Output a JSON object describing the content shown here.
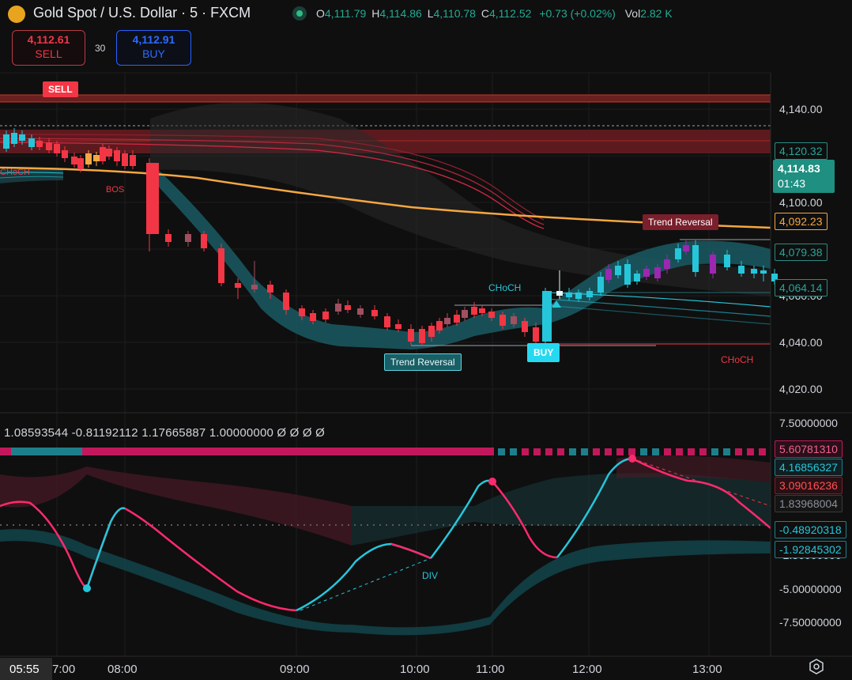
{
  "header": {
    "title": "Gold Spot / U.S. Dollar · 5 · FXCM",
    "ohlc": {
      "o_key": "O",
      "o": "4,111.79",
      "h_key": "H",
      "h": "4,114.86",
      "l_key": "L",
      "l": "4,110.78",
      "c_key": "C",
      "c": "4,112.52",
      "change": "+0.73 (+0.02%)",
      "vol_key": "Vol",
      "vol": "2.82 K"
    }
  },
  "trade": {
    "sell_price": "4,112.61",
    "sell_label": "SELL",
    "buy_price": "4,112.91",
    "buy_label": "BUY",
    "spread": "30"
  },
  "price_axis": {
    "ticks": [
      "4,140.00",
      "4,100.00",
      "4,060.00",
      "4,040.00",
      "4,020.00"
    ],
    "tags": {
      "t4120": "4,120.32",
      "current": "4,114.83",
      "countdown": "01:43",
      "ma": "4,092.23",
      "t4079": "4,079.38",
      "t4064": "4,064.14"
    }
  },
  "annotations": {
    "sell_signal": "SELL",
    "buy_signal": "BUY",
    "choch_left": "CHoCH",
    "bos": "BOS",
    "choch_mid": "CHoCH",
    "choch_right": "CHoCH",
    "trend_reversal_1": "Trend Reversal",
    "trend_reversal_2": "Trend Reversal",
    "div": "DIV"
  },
  "indicator": {
    "values": "1.08593544  -0.81192112  1.17665887  1.00000000  Ø  Ø  Ø  Ø",
    "axis_ticks": [
      "7.50000000",
      "-2.50000000",
      "-5.00000000",
      "-7.50000000"
    ],
    "tags": {
      "a": "5.60781310",
      "b": "4.16856327",
      "c": "3.09016236",
      "d": "1.83968004",
      "e": "-0.48920318",
      "f": "-1.92845302"
    }
  },
  "time_axis": {
    "cursor_time": "05:55",
    "ticks": [
      "7:00",
      "08:00",
      "09:00",
      "10:00",
      "11:00",
      "12:00",
      "13:00"
    ]
  },
  "colors": {
    "bull": "#26c6da",
    "bear": "#f23645",
    "ma_orange": "#f5a742",
    "purple": "#9c27b0"
  },
  "icons": {
    "logo": "gold-coin-logo-icon",
    "live": "market-open-dot-icon",
    "settings": "settings-gear-icon"
  }
}
